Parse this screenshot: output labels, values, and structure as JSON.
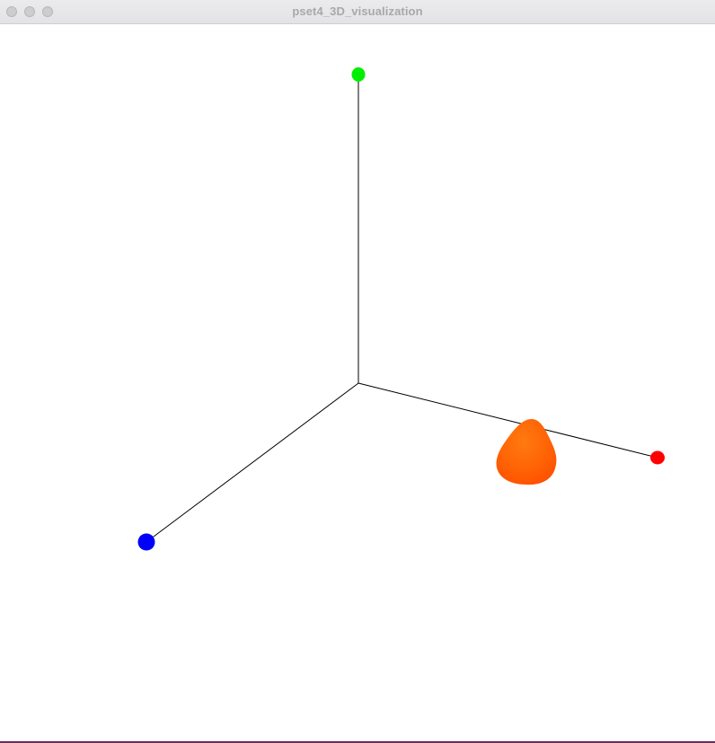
{
  "window": {
    "title": "pset4_3D_visualization",
    "controls": {
      "close": "close-button",
      "minimize": "minimize-button",
      "zoom": "zoom-button"
    }
  },
  "scene": {
    "background": "#ffffff",
    "axes": {
      "color": "#000000",
      "x_endpoint_color": "#ff0000",
      "y_endpoint_color": "#00ee00",
      "z_endpoint_color": "#0000ff"
    },
    "object": {
      "shape": "cone",
      "color": "#ff5a00"
    }
  }
}
